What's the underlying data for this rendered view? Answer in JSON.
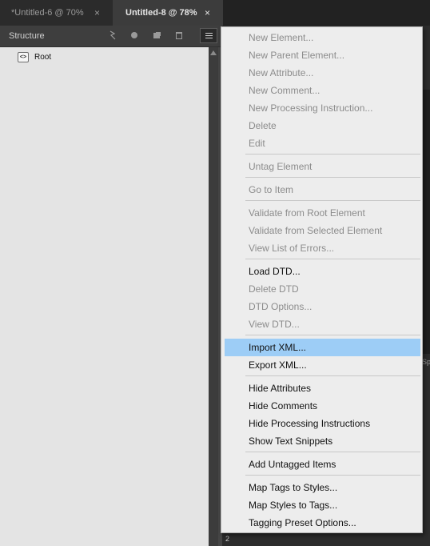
{
  "tabs": [
    {
      "label": "*Untitled-6 @ 70%",
      "close": "×"
    },
    {
      "label": "Untitled-8 @ 78%",
      "close": "×"
    }
  ],
  "panel": {
    "title": "Structure",
    "icons": [
      "snippet-icon",
      "circle-icon",
      "new-element-icon",
      "trash-icon",
      "panel-menu-icon"
    ]
  },
  "tree": {
    "root_icon": "<>",
    "root_label": "Root"
  },
  "background": {
    "sp_text": "Sp",
    "page_number": "2"
  },
  "menu": {
    "highlight_color": "#9dcdf6",
    "items": [
      {
        "label": "New Element...",
        "state": "disabled"
      },
      {
        "label": "New Parent Element...",
        "state": "disabled"
      },
      {
        "label": "New Attribute...",
        "state": "disabled"
      },
      {
        "label": "New Comment...",
        "state": "disabled"
      },
      {
        "label": "New Processing Instruction...",
        "state": "disabled"
      },
      {
        "label": "Delete",
        "state": "disabled"
      },
      {
        "label": "Edit",
        "state": "disabled"
      },
      {
        "label": "Untag Element",
        "state": "disabled"
      },
      {
        "label": "Go to Item",
        "state": "disabled"
      },
      {
        "label": "Validate from Root Element",
        "state": "disabled"
      },
      {
        "label": "Validate from Selected Element",
        "state": "disabled"
      },
      {
        "label": "View List of Errors...",
        "state": "disabled"
      },
      {
        "label": "Load DTD...",
        "state": "enabled"
      },
      {
        "label": "Delete DTD",
        "state": "disabled"
      },
      {
        "label": "DTD Options...",
        "state": "disabled"
      },
      {
        "label": "View DTD...",
        "state": "disabled"
      },
      {
        "label": "Import XML...",
        "state": "highlighted"
      },
      {
        "label": "Export XML...",
        "state": "enabled"
      },
      {
        "label": "Hide Attributes",
        "state": "enabled"
      },
      {
        "label": "Hide Comments",
        "state": "enabled"
      },
      {
        "label": "Hide Processing Instructions",
        "state": "enabled"
      },
      {
        "label": "Show Text Snippets",
        "state": "enabled"
      },
      {
        "label": "Add Untagged Items",
        "state": "enabled"
      },
      {
        "label": "Map Tags to Styles...",
        "state": "enabled"
      },
      {
        "label": "Map Styles to Tags...",
        "state": "enabled"
      },
      {
        "label": "Tagging Preset Options...",
        "state": "enabled"
      }
    ]
  }
}
